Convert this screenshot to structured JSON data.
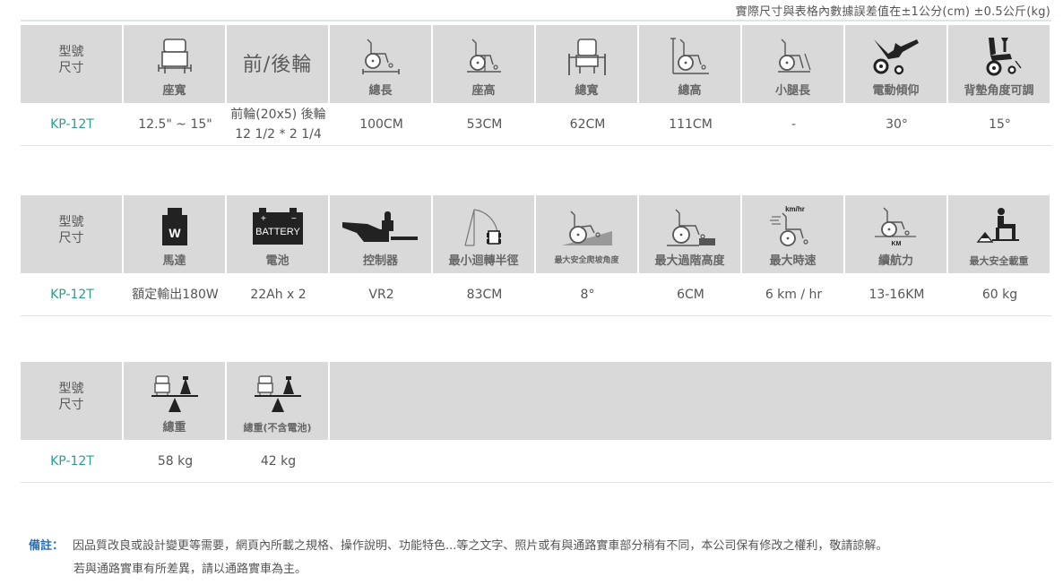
{
  "tolerance_note": "實際尺寸與表格內數據誤差值在±1公分(cm) ±0.5公斤(kg)",
  "corner": {
    "line1": "型號",
    "line2": "尺寸"
  },
  "model": "KP-12T",
  "tables": [
    {
      "headers": [
        {
          "icon": "seat-width-icon",
          "label": "座寬"
        },
        {
          "icon": "",
          "label": "",
          "heading": "前/後輪"
        },
        {
          "icon": "total-length-icon",
          "label": "總長"
        },
        {
          "icon": "seat-height-icon",
          "label": "座高"
        },
        {
          "icon": "total-width-icon",
          "label": "總寬"
        },
        {
          "icon": "total-height-icon",
          "label": "總高"
        },
        {
          "icon": "leg-length-icon",
          "label": "小腿長"
        },
        {
          "icon": "electric-tilt-icon",
          "label": "電動傾仰"
        },
        {
          "icon": "backrest-adjust-icon",
          "label": "背墊角度可調"
        }
      ],
      "values": [
        "12.5\" ~ 15\"",
        "前輪(20x5) 後輪 12 1/2 * 2 1/4",
        "100CM",
        "53CM",
        "62CM",
        "111CM",
        "-",
        "30°",
        "15°"
      ]
    },
    {
      "headers": [
        {
          "icon": "motor-icon",
          "label": "馬達",
          "icon_text": "W"
        },
        {
          "icon": "battery-icon",
          "label": "電池",
          "icon_text": "BATTERY"
        },
        {
          "icon": "controller-icon",
          "label": "控制器"
        },
        {
          "icon": "turning-radius-icon",
          "label": "最小迴轉半徑"
        },
        {
          "icon": "slope-angle-icon",
          "label": "最大安全爬坡角度"
        },
        {
          "icon": "step-height-icon",
          "label": "最大過階高度"
        },
        {
          "icon": "speed-icon",
          "label": "最大時速",
          "icon_text": "km/hr"
        },
        {
          "icon": "range-icon",
          "label": "續航力",
          "icon_text": "KM"
        },
        {
          "icon": "max-load-icon",
          "label": "最大安全載重"
        }
      ],
      "values": [
        "額定輸出180W",
        "22Ah x 2",
        "VR2",
        "83CM",
        "8°",
        "6CM",
        "6 km / hr",
        "13-16KM",
        "60 kg"
      ]
    },
    {
      "headers": [
        {
          "icon": "weight-scale-icon",
          "label": "總重"
        },
        {
          "icon": "weight-scale-icon",
          "label": "總重(不含電池)"
        }
      ],
      "values": [
        "58 kg",
        "42 kg"
      ]
    }
  ],
  "remark": {
    "label": "備註：",
    "line1": "因品質改良或設計變更等需要，網頁內所載之規格、操作說明、功能特色...等之文字、照片或有與通路實車部分稍有不同，本公司保有修改之權利，敬請諒解。",
    "line2": "若與通路實車有所差異，請以通路實車為主。"
  }
}
